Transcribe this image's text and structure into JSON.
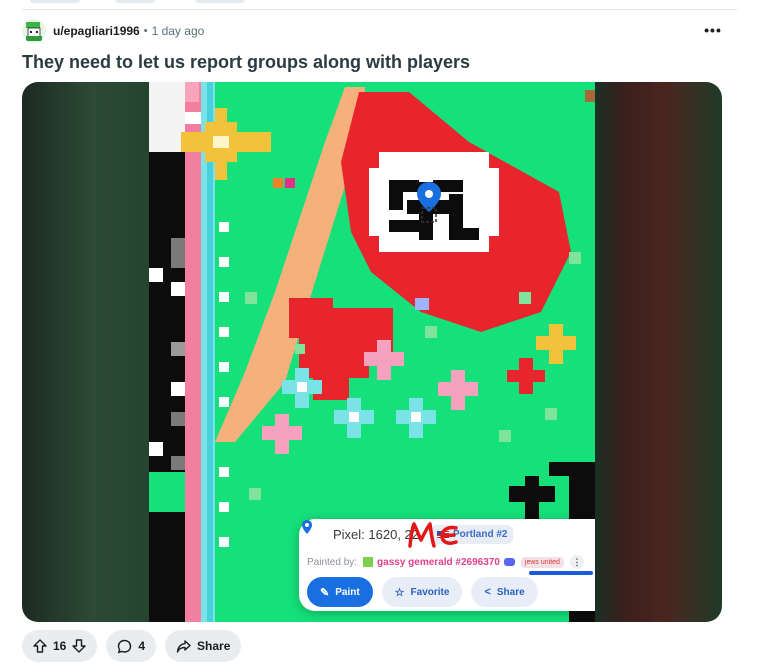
{
  "post": {
    "username": "u/epagliari1996",
    "separator": "•",
    "time": "1 day ago",
    "more_label": "•••",
    "title": "They need to let us report groups along with players"
  },
  "screenshot_card": {
    "pixel_label": "Pixel: 1620, 22",
    "region": "Portland #2",
    "painted_by_label": "Painted by:",
    "painter": "gassy gemerald #2696370",
    "alliance": "jews united",
    "alliance_more": "⋮",
    "close": "✕",
    "buttons": {
      "paint": "Paint",
      "favorite": "Favorite",
      "share": "Share"
    }
  },
  "annotation": {
    "handwritten_text": "ME"
  },
  "actions": {
    "upvotes": "16",
    "comments": "4",
    "share": "Share"
  },
  "colors": {
    "accent": "#1a6fe0",
    "title": "#2a3c42",
    "canvas_green": "#15e07a",
    "flag_red": "#e8242d"
  }
}
